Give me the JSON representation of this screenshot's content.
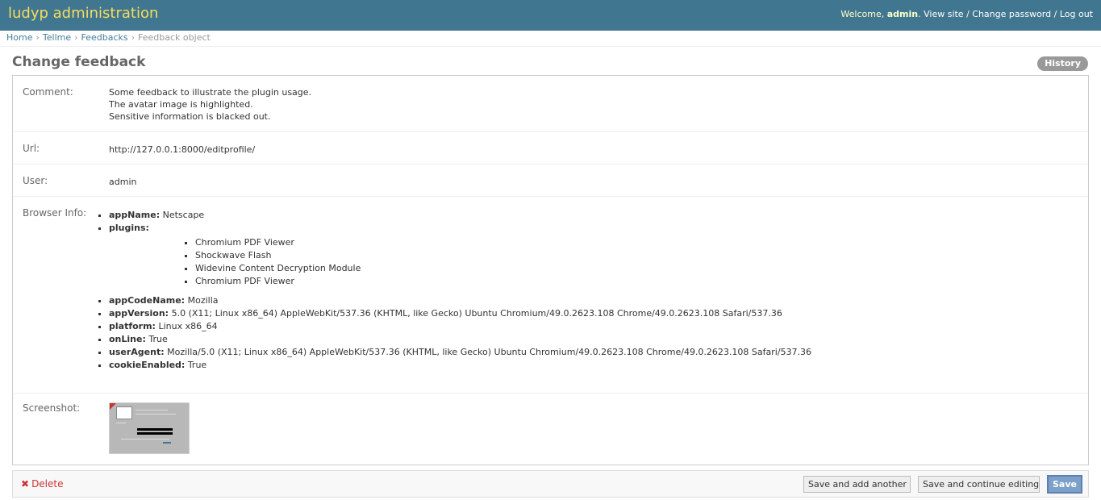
{
  "header": {
    "site_title": "ludyp administration",
    "welcome_text": "Welcome, ",
    "username": "admin",
    "view_site": "View site",
    "change_password": "Change password",
    "log_out": "Log out"
  },
  "breadcrumbs": {
    "home": "Home",
    "app": "Tellme",
    "model": "Feedbacks",
    "current": "Feedback object"
  },
  "page": {
    "title": "Change feedback",
    "history_label": "History"
  },
  "fields": {
    "comment_label": "Comment:",
    "comment_lines": [
      "Some feedback to illustrate the plugin usage.",
      "The avatar image is highlighted.",
      "Sensitive information is blacked out."
    ],
    "url_label": "Url:",
    "url_value": "http://127.0.0.1:8000/editprofile/",
    "user_label": "User:",
    "user_value": "admin",
    "browser_label": "Browser Info:",
    "screenshot_label": "Screenshot:"
  },
  "browser_info": {
    "appName": {
      "key": "appName:",
      "value": "Netscape"
    },
    "plugins": {
      "key": "plugins:",
      "items": [
        "Chromium PDF Viewer",
        "Shockwave Flash",
        "Widevine Content Decryption Module",
        "Chromium PDF Viewer"
      ]
    },
    "appCodeName": {
      "key": "appCodeName:",
      "value": "Mozilla"
    },
    "appVersion": {
      "key": "appVersion:",
      "value": "5.0 (X11; Linux x86_64) AppleWebKit/537.36 (KHTML, like Gecko) Ubuntu Chromium/49.0.2623.108 Chrome/49.0.2623.108 Safari/537.36"
    },
    "platform": {
      "key": "platform:",
      "value": "Linux x86_64"
    },
    "onLine": {
      "key": "onLine:",
      "value": "True"
    },
    "userAgent": {
      "key": "userAgent:",
      "value": "Mozilla/5.0 (X11; Linux x86_64) AppleWebKit/537.36 (KHTML, like Gecko) Ubuntu Chromium/49.0.2623.108 Chrome/49.0.2623.108 Safari/537.36"
    },
    "cookieEnabled": {
      "key": "cookieEnabled:",
      "value": "True"
    }
  },
  "actions": {
    "delete_label": "Delete",
    "save_add_another": "Save and add another",
    "save_continue": "Save and continue editing",
    "save": "Save"
  },
  "icons": {
    "delete": "close-icon",
    "screenshot": "image-thumbnail"
  },
  "colors": {
    "header_bg": "#417690",
    "branding": "#f5dd5d",
    "link": "#447e9b",
    "delete": "#cc3434",
    "save_button": "#7ca0c7"
  }
}
